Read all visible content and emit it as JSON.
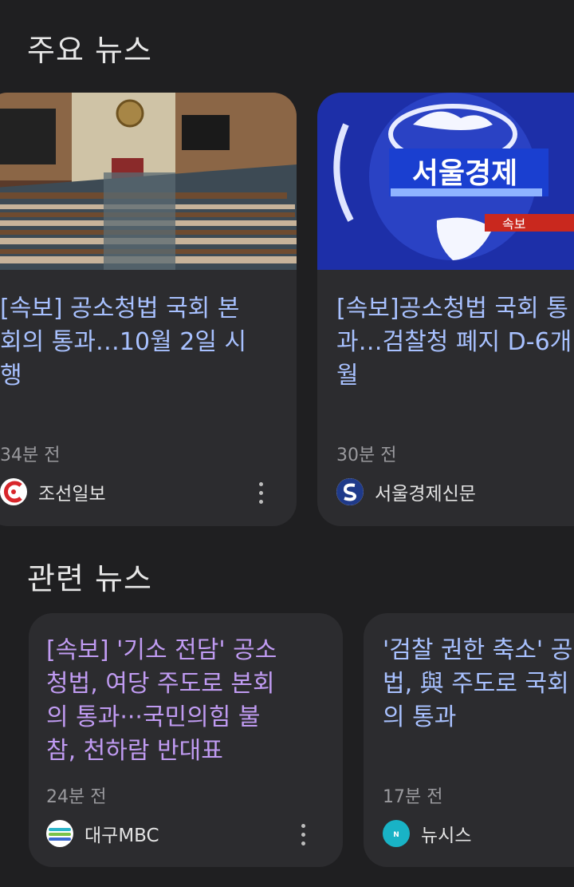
{
  "sections": {
    "top": {
      "title": "주요 뉴스",
      "cards": [
        {
          "headline": "[속보] 공소청법 국회 본\n회의 통과…10월 2일 시\n행",
          "time": "34분 전",
          "source": "조선일보",
          "logo_icon": "chosun-logo-icon"
        },
        {
          "headline": "[속보]공소청법 국회 통\n과…검찰청 폐지 D-6개\n월",
          "time": "30분 전",
          "source": "서울경제신문",
          "logo_icon": "seoul-economic-logo-icon",
          "image_text": {
            "brand": "서울경제",
            "tag": "속보"
          }
        }
      ]
    },
    "related": {
      "title": "관련 뉴스",
      "cards": [
        {
          "headline": "[속보] '기소 전담' 공소\n청법, 여당 주도로 본회\n의 통과···국민의힘 불\n참, 천하람 반대표",
          "time": "24분 전",
          "source": "대구MBC",
          "logo_icon": "daegu-mbc-logo-icon"
        },
        {
          "headline": "'검찰 권한 축소' 공\n법, 與 주도로 국회\n의 통과",
          "time": "17분 전",
          "source": "뉴시스",
          "logo_icon": "newsis-logo-icon"
        }
      ]
    }
  },
  "colors": {
    "background": "#1f1f21",
    "card": "#2c2c2f",
    "headline_blue": "#a8c1ff",
    "headline_purple": "#c09bf2",
    "muted": "#9a9a9e"
  }
}
